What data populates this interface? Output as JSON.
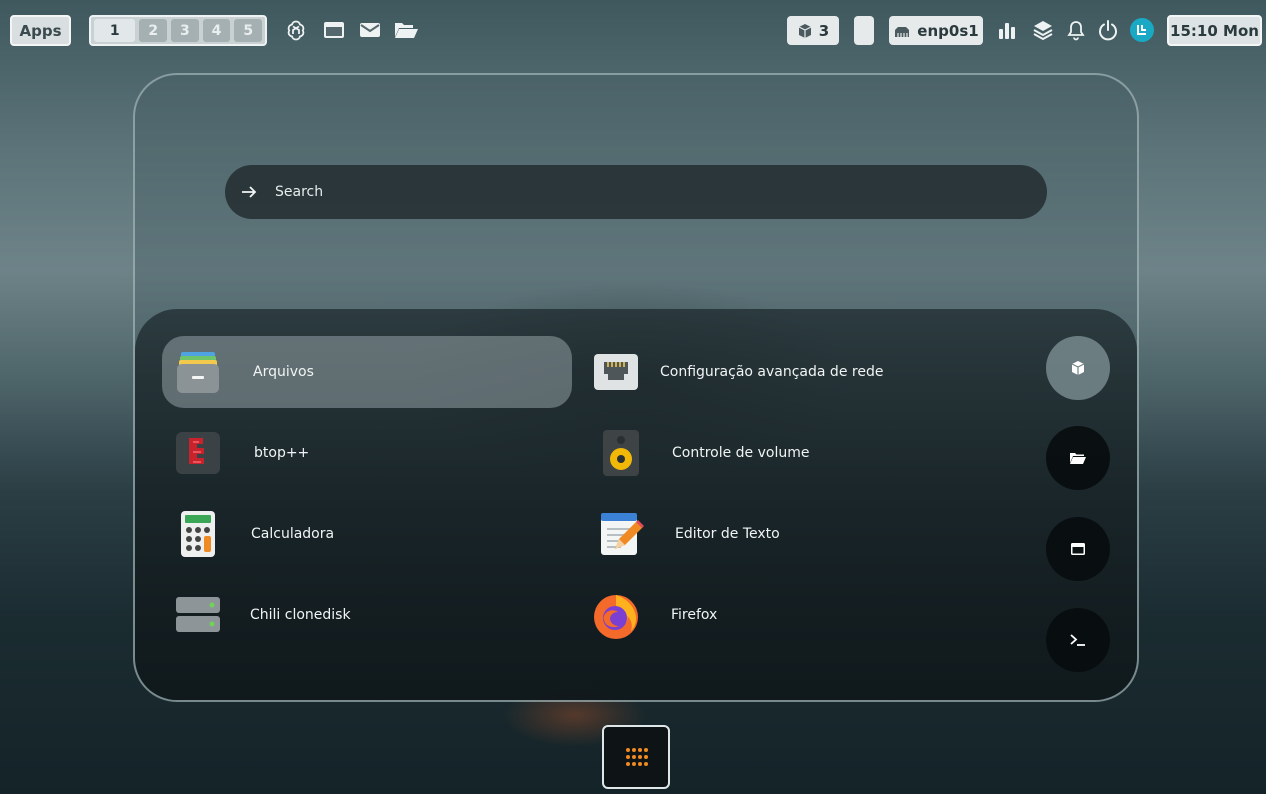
{
  "topbar": {
    "apps_label": "Apps",
    "workspaces": [
      "1",
      "2",
      "3",
      "4",
      "5"
    ],
    "active_workspace": "1",
    "quick_icons": [
      "chatgpt-icon",
      "window-icon",
      "mail-icon",
      "folder-open-icon"
    ],
    "packages_count": "3",
    "network_name": "enp0s1",
    "clock": "15:10 Mon",
    "tray_icons": [
      "bar-chart-icon",
      "layers-icon",
      "bell-icon",
      "power-icon",
      "avatar-icon"
    ]
  },
  "launcher": {
    "search_placeholder": "Search",
    "apps": [
      {
        "label": "Arquivos",
        "icon": "files-app-icon",
        "selected": true
      },
      {
        "label": "Configuração avançada de rede",
        "icon": "network-config-app-icon"
      },
      {
        "label": "btop++",
        "icon": "btop-app-icon"
      },
      {
        "label": "Controle de volume",
        "icon": "speaker-app-icon"
      },
      {
        "label": "Calculadora",
        "icon": "calculator-app-icon"
      },
      {
        "label": "Editor de Texto",
        "icon": "text-editor-app-icon"
      },
      {
        "label": "Chili clonedisk",
        "icon": "disk-app-icon"
      },
      {
        "label": "Firefox",
        "icon": "firefox-app-icon"
      }
    ],
    "side_buttons": [
      "package-icon",
      "folder-icon",
      "window-icon",
      "terminal-icon"
    ]
  },
  "dock": {
    "icon": "app-grid-icon"
  },
  "colors": {
    "accent_orange": "#f08a24",
    "avatar_teal": "#19a9c4"
  }
}
